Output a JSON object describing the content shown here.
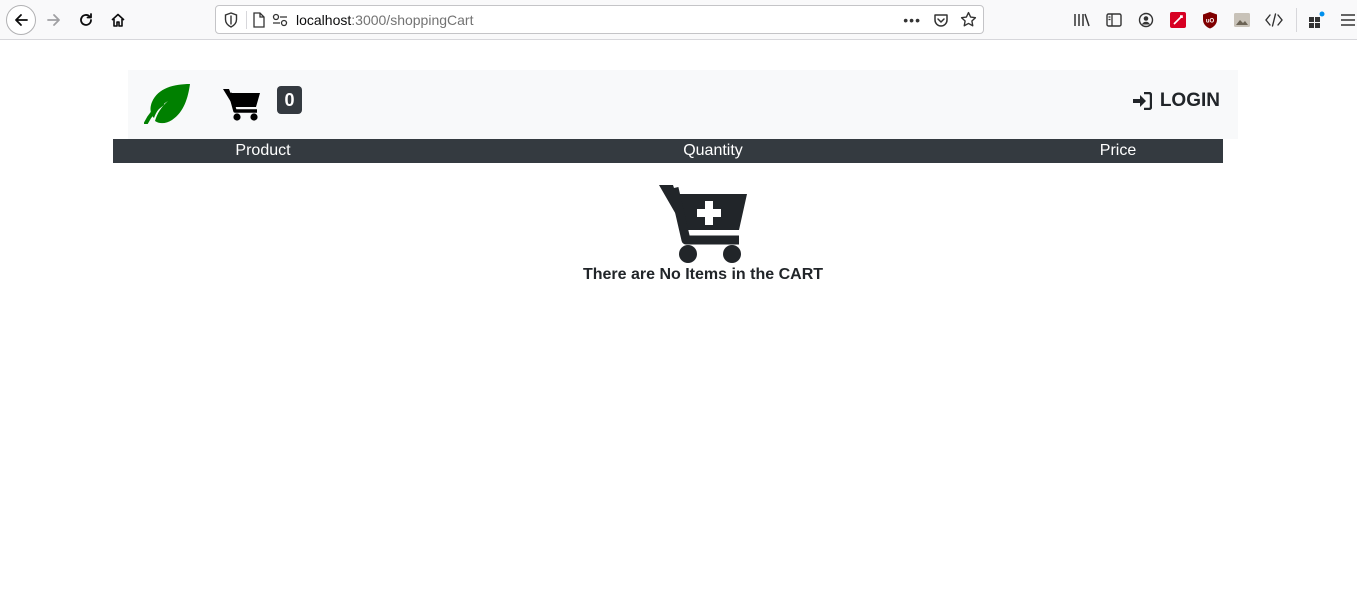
{
  "browser": {
    "url_host": "localhost",
    "url_rest": ":3000/shoppingCart",
    "more_label": "•••"
  },
  "navbar": {
    "cart_count": "0",
    "login_label": "LOGIN",
    "brand_color": "#008000"
  },
  "cart_table": {
    "headers": [
      "Product",
      "Quantity",
      "Price"
    ],
    "header_bg": "#343a40"
  },
  "empty_state": {
    "message": "There are No Items in the CART"
  }
}
